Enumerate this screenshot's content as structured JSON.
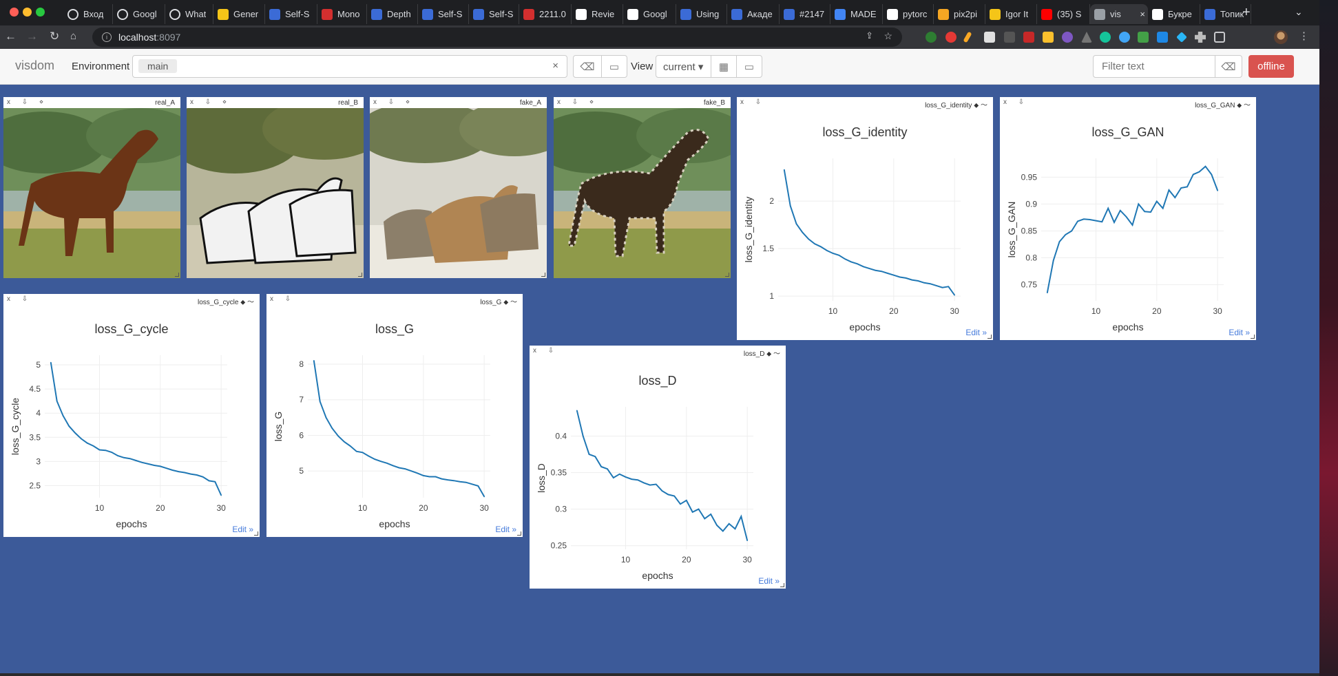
{
  "browser": {
    "tabs": [
      {
        "label": "Вход",
        "color": "#1e1f22",
        "icon": "google-icon"
      },
      {
        "label": "Googl",
        "color": "#1e1f22",
        "icon": "google-icon"
      },
      {
        "label": "What",
        "color": "#1e1f22",
        "icon": "chrome-icon"
      },
      {
        "label": "Gener",
        "color": "#f5c518",
        "icon": "hf-icon"
      },
      {
        "label": "Self-S",
        "color": "#3b6bd6",
        "icon": "ieee-icon"
      },
      {
        "label": "Mono",
        "color": "#d32f2f",
        "icon": "k-icon"
      },
      {
        "label": "Depth",
        "color": "#3b6bd6",
        "icon": "sds-icon"
      },
      {
        "label": "Self-S",
        "color": "#3b6bd6",
        "icon": "ieee-icon"
      },
      {
        "label": "Self-S",
        "color": "#3b6bd6",
        "icon": "ieee-icon"
      },
      {
        "label": "2211.0",
        "color": "#d32f2f",
        "icon": "pdf-icon"
      },
      {
        "label": "Revie",
        "color": "#ffffff",
        "icon": "medium-icon"
      },
      {
        "label": "Googl",
        "color": "#ffffff",
        "icon": "medium-icon"
      },
      {
        "label": "Using",
        "color": "#3b6bd6",
        "icon": "sds-icon"
      },
      {
        "label": "Акаде",
        "color": "#3b6bd6",
        "icon": "habr-icon"
      },
      {
        "label": "#2147",
        "color": "#3b6bd6",
        "icon": "habr-icon"
      },
      {
        "label": "MADE",
        "color": "#4285f4",
        "icon": "doc-icon"
      },
      {
        "label": "pytorc",
        "color": "#ffffff",
        "icon": "github-icon"
      },
      {
        "label": "pix2pi",
        "color": "#f5a623",
        "icon": "colab-icon"
      },
      {
        "label": "Igor It",
        "color": "#f5c518",
        "icon": "grid-icon"
      },
      {
        "label": "(35) S",
        "color": "#ff0000",
        "icon": "youtube-icon"
      },
      {
        "label": "vis",
        "color": "#9aa0a6",
        "icon": "globe-icon"
      },
      {
        "label": "Букре",
        "color": "#ffffff",
        "icon": "wiki-icon"
      },
      {
        "label": "Топик",
        "color": "#3b6bd6",
        "icon": "habr-icon"
      }
    ],
    "active_tab": 20,
    "url_host": "localhost",
    "url_port": ":8097"
  },
  "visdom": {
    "brand": "visdom",
    "env_label": "Environment",
    "env_selected": "main",
    "env_clear": "×",
    "view_label": "View",
    "view_selected": "current ▾",
    "filter_placeholder": "Filter text",
    "offline_label": "offline"
  },
  "images": [
    {
      "title": "real_A",
      "controls": "x ⇩ ⋄"
    },
    {
      "title": "real_B",
      "controls": "x ⇩ ⋄"
    },
    {
      "title": "fake_A",
      "controls": "x ⇩ ⋄"
    },
    {
      "title": "fake_B",
      "controls": "x ⇩ ⋄"
    }
  ],
  "edit_label": "Edit »",
  "chart_data": [
    {
      "type": "line",
      "title": "loss_G_identity",
      "xlabel": "epochs",
      "ylabel": "loss_G_identity",
      "xlim": [
        1,
        31
      ],
      "ylim": [
        0.95,
        2.45
      ],
      "xticks": [
        10,
        20,
        30
      ],
      "yticks": [
        1,
        1.5,
        2
      ],
      "ytick_labels": [
        "1",
        "1.5",
        "2"
      ],
      "x": [
        2,
        3,
        4,
        5,
        6,
        7,
        8,
        9,
        10,
        11,
        12,
        13,
        14,
        15,
        16,
        17,
        18,
        19,
        20,
        21,
        22,
        23,
        24,
        25,
        26,
        27,
        28,
        29,
        30
      ],
      "y": [
        2.33,
        1.95,
        1.76,
        1.67,
        1.6,
        1.55,
        1.52,
        1.48,
        1.45,
        1.43,
        1.39,
        1.36,
        1.34,
        1.31,
        1.29,
        1.27,
        1.26,
        1.24,
        1.22,
        1.2,
        1.19,
        1.17,
        1.16,
        1.14,
        1.13,
        1.11,
        1.09,
        1.1,
        1.01
      ]
    },
    {
      "type": "line",
      "title": "loss_G_GAN",
      "xlabel": "epochs",
      "ylabel": "loss_G_GAN",
      "xlim": [
        1,
        31
      ],
      "ylim": [
        0.72,
        0.985
      ],
      "xticks": [
        10,
        20,
        30
      ],
      "yticks": [
        0.75,
        0.8,
        0.85,
        0.9,
        0.95
      ],
      "ytick_labels": [
        "0.75",
        "0.8",
        "0.85",
        "0.9",
        "0.95"
      ],
      "x": [
        2,
        3,
        4,
        5,
        6,
        7,
        8,
        9,
        10,
        11,
        12,
        13,
        14,
        15,
        16,
        17,
        18,
        19,
        20,
        21,
        22,
        23,
        24,
        25,
        26,
        27,
        28,
        29,
        30
      ],
      "y": [
        0.735,
        0.795,
        0.83,
        0.843,
        0.85,
        0.868,
        0.872,
        0.871,
        0.869,
        0.867,
        0.892,
        0.866,
        0.888,
        0.876,
        0.861,
        0.9,
        0.886,
        0.885,
        0.905,
        0.892,
        0.926,
        0.912,
        0.93,
        0.932,
        0.955,
        0.96,
        0.97,
        0.955,
        0.925,
        0.937
      ]
    },
    {
      "type": "line",
      "title": "loss_G_cycle",
      "xlabel": "epochs",
      "ylabel": "loss_G_cycle",
      "xlim": [
        1,
        31
      ],
      "ylim": [
        2.25,
        5.2
      ],
      "xticks": [
        10,
        20,
        30
      ],
      "yticks": [
        2.5,
        3,
        3.5,
        4,
        4.5,
        5
      ],
      "ytick_labels": [
        "2.5",
        "3",
        "3.5",
        "4",
        "4.5",
        "5"
      ],
      "x": [
        2,
        3,
        4,
        5,
        6,
        7,
        8,
        9,
        10,
        11,
        12,
        13,
        14,
        15,
        16,
        17,
        18,
        19,
        20,
        21,
        22,
        23,
        24,
        25,
        26,
        27,
        28,
        29,
        30
      ],
      "y": [
        5.05,
        4.25,
        3.95,
        3.73,
        3.59,
        3.47,
        3.38,
        3.32,
        3.24,
        3.23,
        3.19,
        3.12,
        3.08,
        3.06,
        3.02,
        2.98,
        2.95,
        2.92,
        2.9,
        2.86,
        2.82,
        2.79,
        2.77,
        2.74,
        2.72,
        2.68,
        2.6,
        2.58,
        2.3
      ]
    },
    {
      "type": "line",
      "title": "loss_G",
      "xlabel": "epochs",
      "ylabel": "loss_G",
      "xlim": [
        1,
        31
      ],
      "ylim": [
        4.25,
        8.25
      ],
      "xticks": [
        10,
        20,
        30
      ],
      "yticks": [
        5,
        6,
        7,
        8
      ],
      "ytick_labels": [
        "5",
        "6",
        "7",
        "8"
      ],
      "x": [
        2,
        3,
        4,
        5,
        6,
        7,
        8,
        9,
        10,
        11,
        12,
        13,
        14,
        15,
        16,
        17,
        18,
        19,
        20,
        21,
        22,
        23,
        24,
        25,
        26,
        27,
        28,
        29,
        30
      ],
      "y": [
        8.1,
        6.95,
        6.5,
        6.2,
        5.98,
        5.82,
        5.7,
        5.55,
        5.52,
        5.42,
        5.33,
        5.27,
        5.22,
        5.15,
        5.09,
        5.06,
        5.0,
        4.94,
        4.87,
        4.84,
        4.84,
        4.78,
        4.75,
        4.73,
        4.7,
        4.68,
        4.63,
        4.58,
        4.28
      ]
    },
    {
      "type": "line",
      "title": "loss_D",
      "xlabel": "epochs",
      "ylabel": "loss_D",
      "xlim": [
        1,
        31
      ],
      "ylim": [
        0.245,
        0.44
      ],
      "xticks": [
        10,
        20,
        30
      ],
      "yticks": [
        0.25,
        0.3,
        0.35,
        0.4
      ],
      "ytick_labels": [
        "0.25",
        "0.3",
        "0.35",
        "0.4"
      ],
      "x": [
        2,
        3,
        4,
        5,
        6,
        7,
        8,
        9,
        10,
        11,
        12,
        13,
        14,
        15,
        16,
        17,
        18,
        19,
        20,
        21,
        22,
        23,
        24,
        25,
        26,
        27,
        28,
        29,
        30
      ],
      "y": [
        0.435,
        0.4,
        0.375,
        0.372,
        0.358,
        0.355,
        0.343,
        0.348,
        0.344,
        0.341,
        0.34,
        0.336,
        0.333,
        0.334,
        0.325,
        0.32,
        0.318,
        0.307,
        0.312,
        0.296,
        0.3,
        0.287,
        0.293,
        0.278,
        0.27,
        0.28,
        0.273,
        0.29,
        0.257
      ]
    }
  ]
}
